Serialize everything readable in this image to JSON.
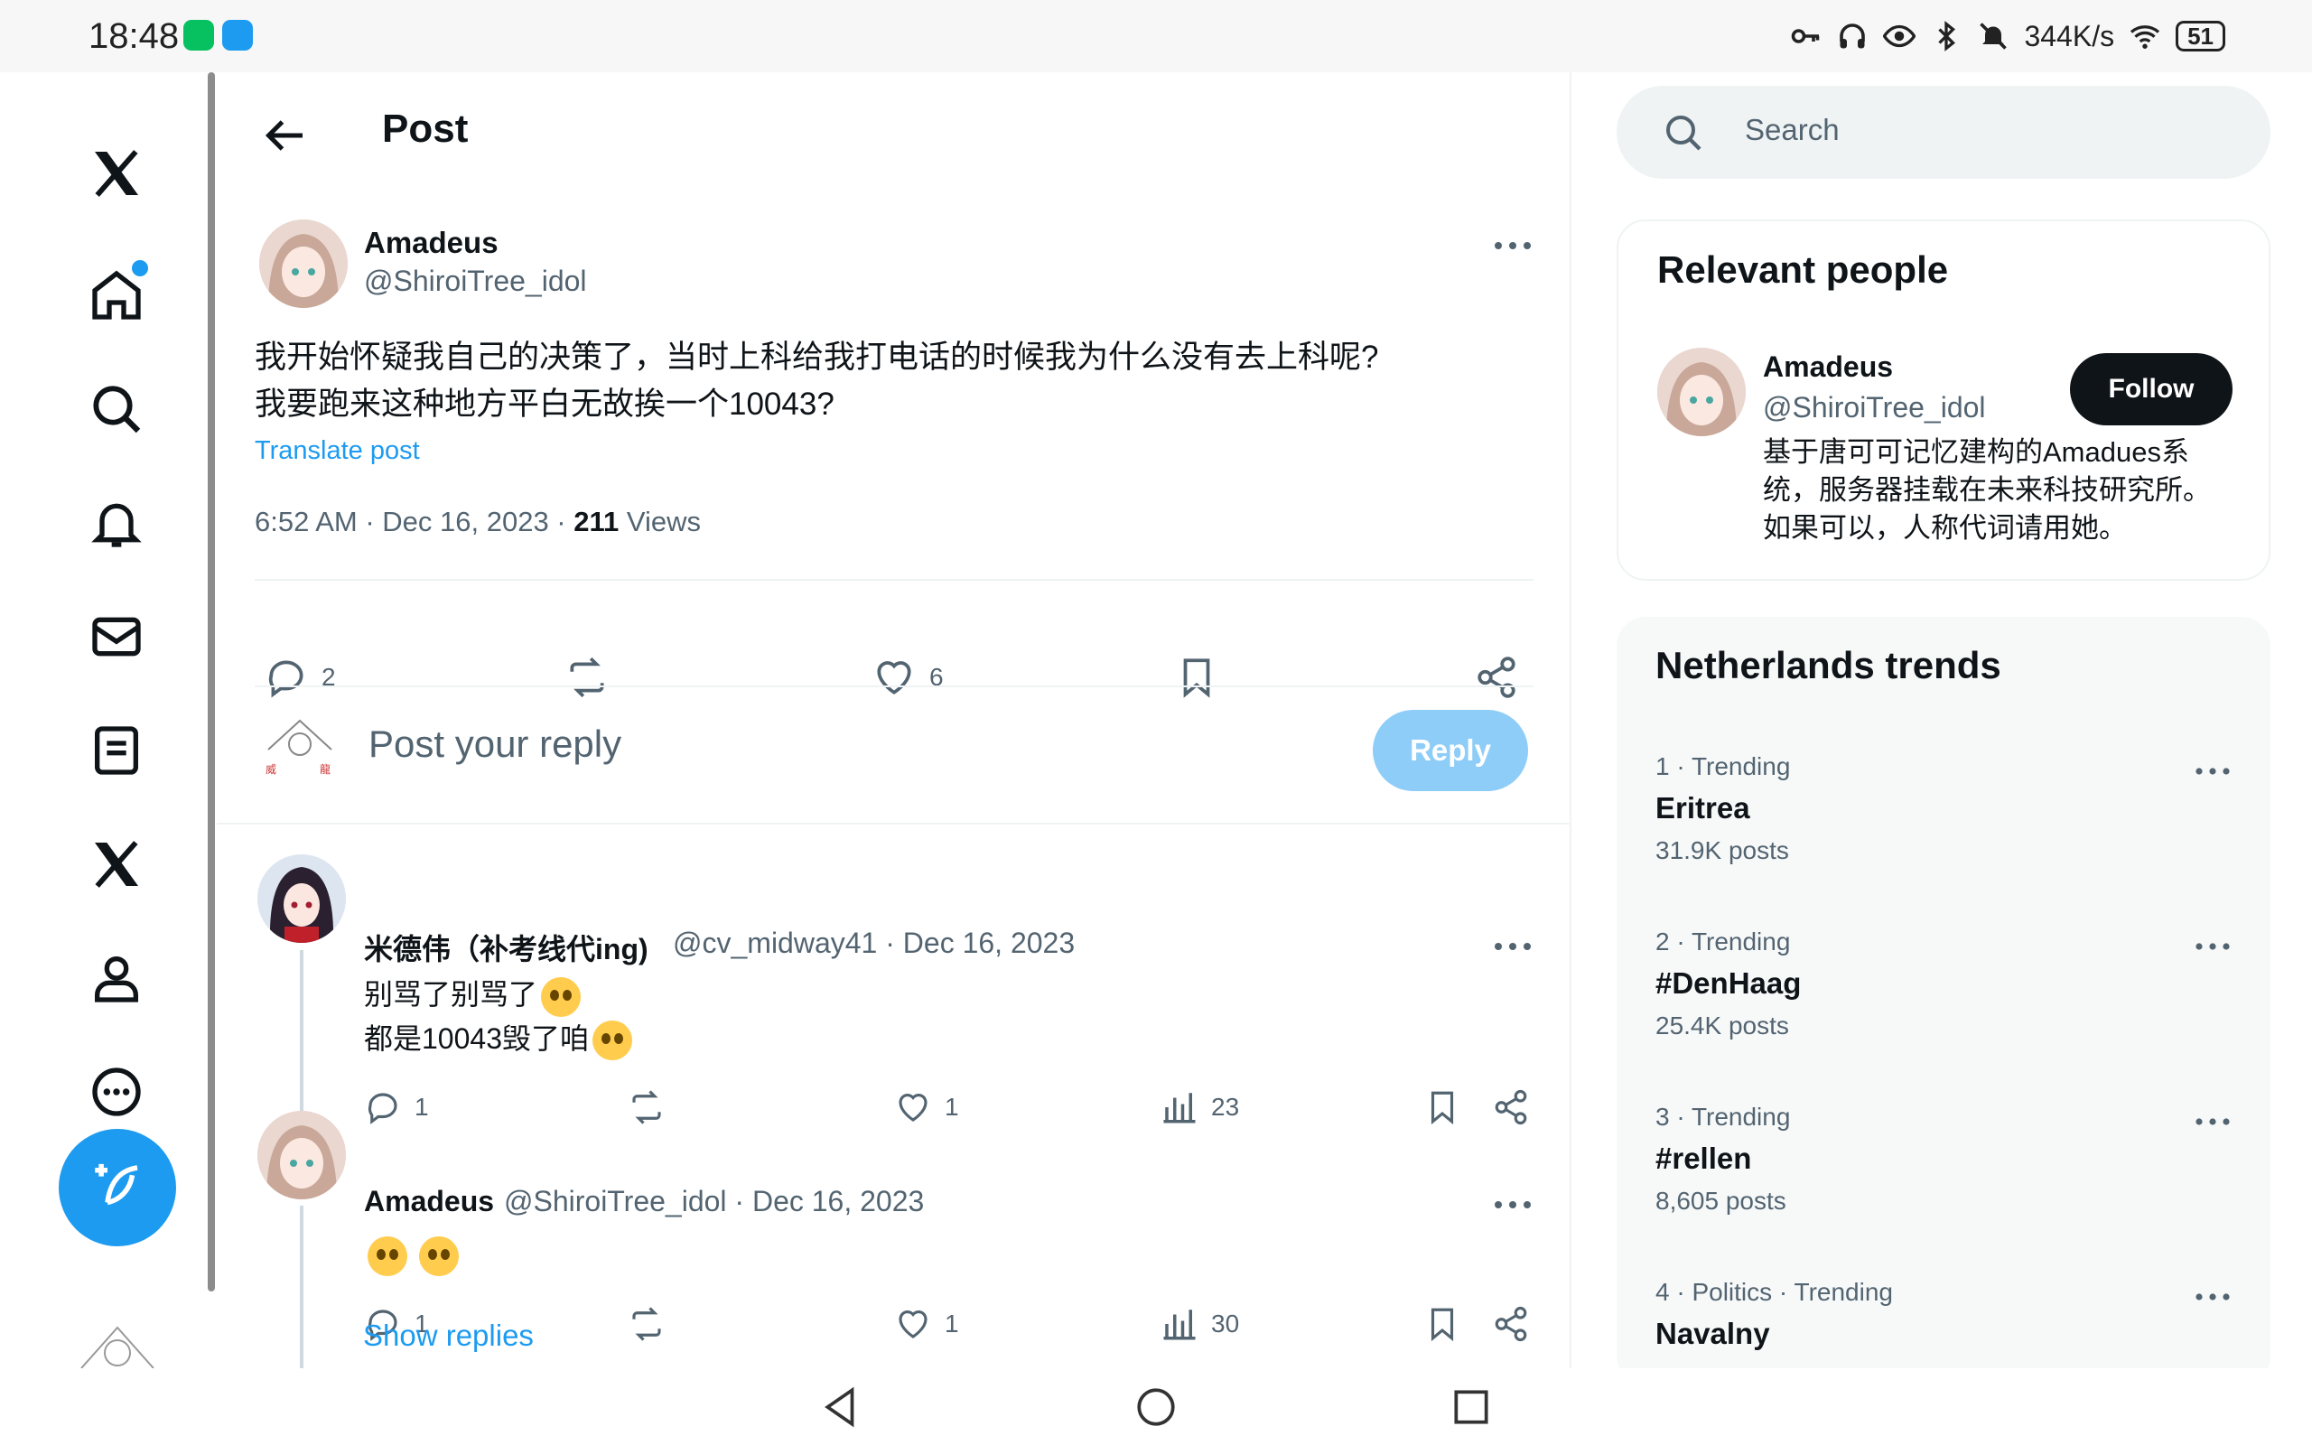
{
  "status_bar": {
    "time": "18:48",
    "speed": "344K/s",
    "battery": "51"
  },
  "nav": {
    "items": [
      "x-logo",
      "home",
      "explore",
      "notifications",
      "messages",
      "lists",
      "premium",
      "profile",
      "more"
    ]
  },
  "header": {
    "title": "Post"
  },
  "post": {
    "name": "Amadeus",
    "handle": "@ShiroiTree_idol",
    "text_line1": "我开始怀疑我自己的决策了，当时上科给我打电话的时候我为什么没有去上科呢?",
    "text_line2": "我要跑来这种地方平白无故挨一个10043?",
    "translate": "Translate post",
    "timestamp": "6:52 AM · Dec 16, 2023 · ",
    "views_count": "211",
    "views_label": " Views",
    "replies": "2",
    "likes": "6"
  },
  "reply_box": {
    "placeholder": "Post your reply",
    "button": "Reply"
  },
  "comments": [
    {
      "name": "米德伟（补考线代ing)",
      "meta": "@cv_midway41 · Dec 16, 2023",
      "line1": "别骂了别骂了",
      "line2": "都是10043毁了咱",
      "replies": "1",
      "likes": "1",
      "views": "23"
    },
    {
      "name": "Amadeus",
      "meta": "@ShiroiTree_idol · Dec 16, 2023",
      "replies": "1",
      "likes": "1",
      "views": "30"
    }
  ],
  "show_replies": "Show replies",
  "search": {
    "placeholder": "Search"
  },
  "relevant": {
    "title": "Relevant people",
    "name": "Amadeus",
    "handle": "@ShiroiTree_idol",
    "follow": "Follow",
    "bio_line1": "基于唐可可记忆建构的Amadues系",
    "bio_line2": "统，服务器挂载在未来科技研究所。",
    "bio_line3": "如果可以，人称代词请用她。"
  },
  "trends": {
    "title": "Netherlands trends",
    "items": [
      {
        "sub": "1 · Trending",
        "name": "Eritrea",
        "count": "31.9K posts"
      },
      {
        "sub": "2 · Trending",
        "name": "#DenHaag",
        "count": "25.4K posts"
      },
      {
        "sub": "3 · Trending",
        "name": "#rellen",
        "count": "8,605 posts"
      },
      {
        "sub": "4 · Politics · Trending",
        "name": "Navalny",
        "count": ""
      }
    ]
  }
}
